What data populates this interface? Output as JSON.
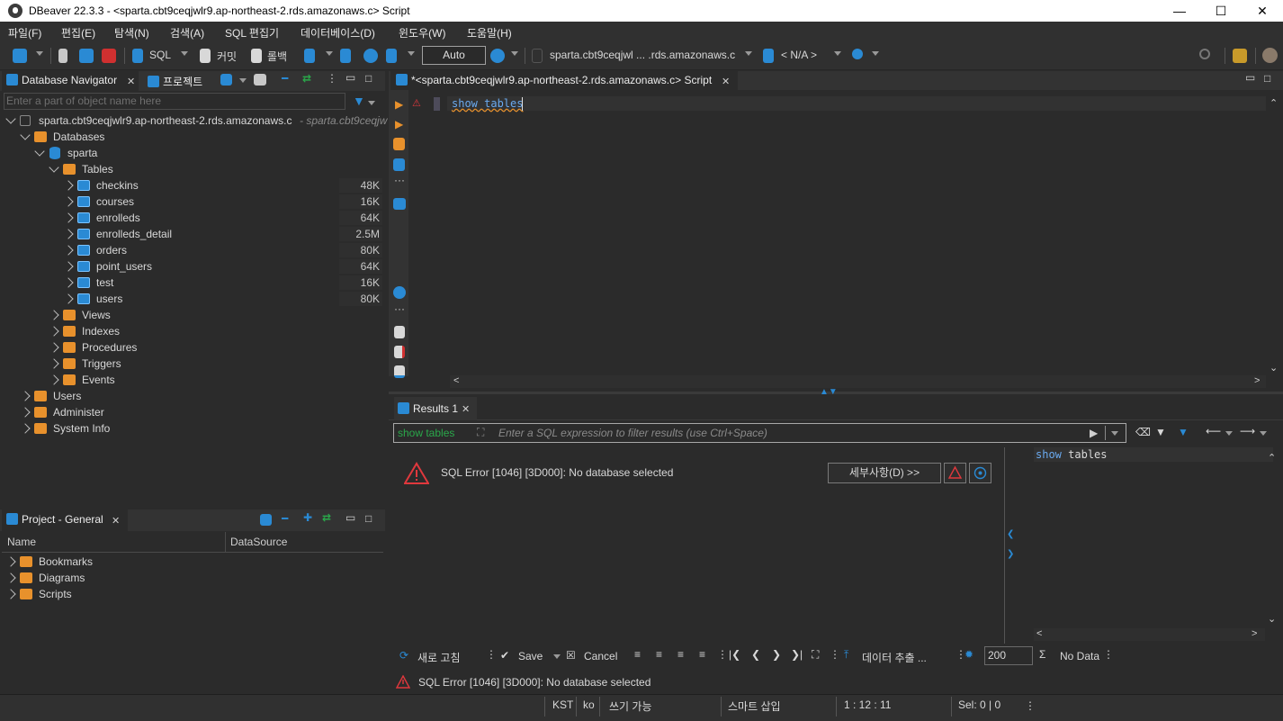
{
  "window": {
    "title": "DBeaver 22.3.3 - <sparta.cbt9ceqjwlr9.ap-northeast-2.rds.amazonaws.c> Script",
    "minimize": "—",
    "maximize": "☐",
    "close": "✕"
  },
  "menu": {
    "items": [
      "파일(F)",
      "편집(E)",
      "탐색(N)",
      "검색(A)",
      "SQL 편집기",
      "데이터베이스(D)",
      "윈도우(W)",
      "도움말(H)"
    ]
  },
  "toolbar": {
    "sql_label": "SQL",
    "commit_label": "커밋",
    "rollback_label": "롤백",
    "transaction_mode": "Auto",
    "datasource": "sparta.cbt9ceqjwl ... .rds.amazonaws.c",
    "schema": "< N/A >"
  },
  "navigator": {
    "tab_label": "Database Navigator",
    "tab2_label": "프로젝트",
    "filter_placeholder": "Enter a part of object name here",
    "connection": {
      "label": "sparta.cbt9ceqjwlr9.ap-northeast-2.rds.amazonaws.c",
      "suffix": "- sparta.cbt9ceqjw"
    },
    "databases_label": "Databases",
    "schema_label": "sparta",
    "tables_label": "Tables",
    "tables": [
      {
        "name": "checkins",
        "size": "48K"
      },
      {
        "name": "courses",
        "size": "16K"
      },
      {
        "name": "enrolleds",
        "size": "64K"
      },
      {
        "name": "enrolleds_detail",
        "size": "2.5M"
      },
      {
        "name": "orders",
        "size": "80K"
      },
      {
        "name": "point_users",
        "size": "64K"
      },
      {
        "name": "test",
        "size": "16K"
      },
      {
        "name": "users",
        "size": "80K"
      }
    ],
    "schema_folders": [
      "Views",
      "Indexes",
      "Procedures",
      "Triggers",
      "Events"
    ],
    "root_folders": [
      "Users",
      "Administer",
      "System Info"
    ]
  },
  "project": {
    "tab_label": "Project - General",
    "col_name": "Name",
    "col_datasource": "DataSource",
    "items": [
      "Bookmarks",
      "Diagrams",
      "Scripts"
    ]
  },
  "editor": {
    "tab_label": "*<sparta.cbt9ceqjwlr9.ap-northeast-2.rds.amazonaws.c> Script",
    "code": "show tables"
  },
  "results": {
    "tab_label": "Results 1",
    "filter_chip": "show tables",
    "filter_placeholder": "Enter a SQL expression to filter results (use Ctrl+Space)",
    "error_message": "SQL Error [1046] [3D000]: No database selected",
    "details_button": "세부사항(D) >>",
    "side_query": "show tables",
    "refresh_label": "새로 고침",
    "save_label": "Save",
    "cancel_label": "Cancel",
    "export_label": "데이터 추출 ...",
    "fetch_size": "200",
    "no_data_label": "No Data",
    "bottom_error": "SQL Error [1046] [3D000]: No database selected"
  },
  "statusbar": {
    "timezone": "KST",
    "locale": "ko",
    "mode": "쓰기 가능",
    "insert_mode": "스마트 삽입",
    "position": "1 : 12 : 11",
    "selection": "Sel: 0 | 0"
  },
  "colors": {
    "background": "#2b2b2b",
    "accent_blue": "#2a8ad4",
    "folder_orange": "#e8912c",
    "error_red": "#e0383d"
  }
}
